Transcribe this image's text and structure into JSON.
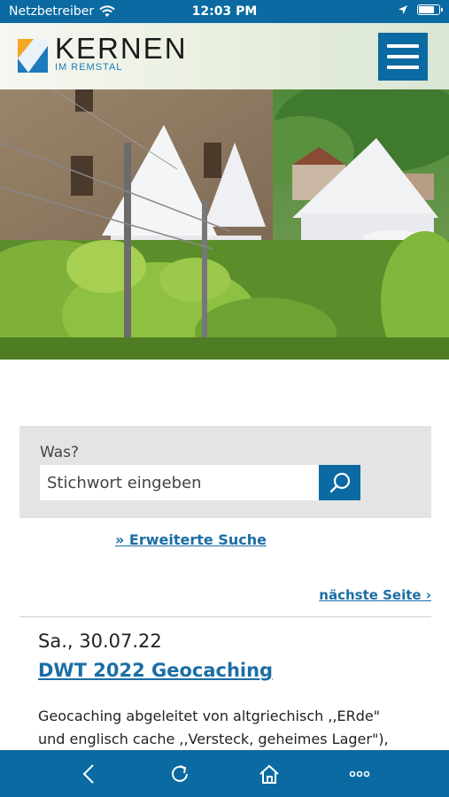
{
  "status_bar": {
    "carrier": "Netzbetreiber",
    "time": "12:03 PM",
    "battery_level": 0.85
  },
  "header": {
    "brand_name": "KERNEN",
    "brand_sub": "IM REMSTAL",
    "menu_icon": "hamburger-menu-icon",
    "colors": {
      "accent": "#0a6aa1",
      "link": "#1b6ea5"
    }
  },
  "hero": {
    "icon": "photo-vineyard-tents"
  },
  "search": {
    "label": "Was?",
    "placeholder": "Stichwort eingeben",
    "value": "",
    "button_icon": "search-icon",
    "advanced_link": "» Erweiterte Suche"
  },
  "pagination": {
    "next_label": "nächste Seite ›"
  },
  "event": {
    "date": "Sa., 30.07.22",
    "title": "DWT 2022 Geocaching",
    "description": "Geocaching abgeleitet von altgriechisch ,,ERde\" und englisch cache ,,Versteck, geheimes Lager\"),"
  },
  "toolbar": {
    "items": [
      {
        "name": "back",
        "icon": "chevron-left-icon"
      },
      {
        "name": "reload",
        "icon": "reload-icon"
      },
      {
        "name": "home",
        "icon": "home-icon"
      },
      {
        "name": "more",
        "icon": "more-icon"
      }
    ]
  }
}
